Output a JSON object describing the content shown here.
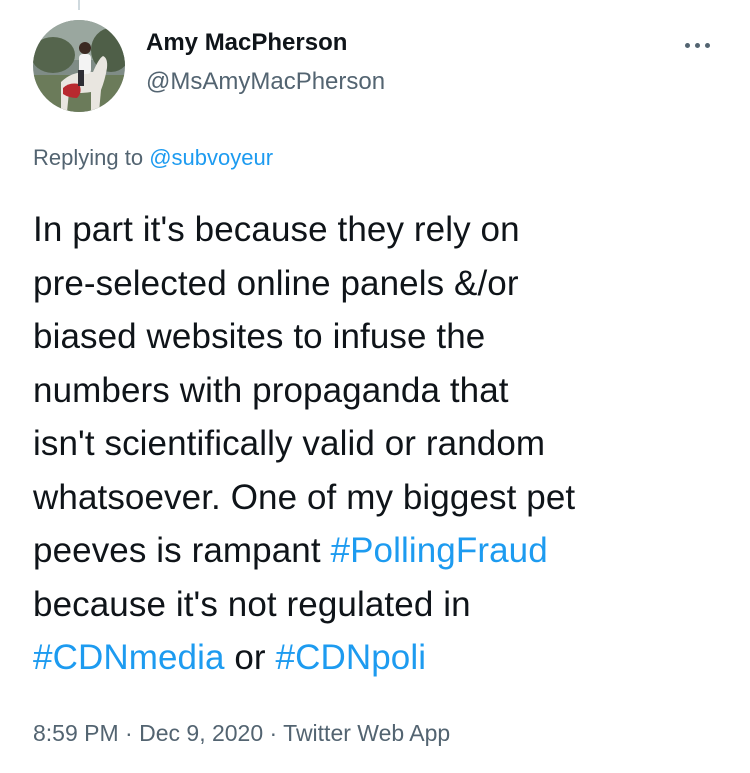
{
  "tweet": {
    "author_name": "Amy MacPherson",
    "author_handle": "@MsAmyMacPherson",
    "replying_prefix": "Replying to ",
    "replying_to": "@subvoyeur",
    "lines": [
      {
        "text": "In part it's because they rely on"
      },
      {
        "text": "pre-selected online panels &/or"
      },
      {
        "text": "biased websites to infuse the"
      },
      {
        "text": "numbers with propaganda that"
      },
      {
        "text": "isn't scientifically valid or random"
      },
      {
        "text": "whatsoever. One of my biggest pet"
      },
      {
        "text": "peeves is rampant ",
        "tag": "#PollingFraud"
      },
      {
        "text": "because it's not regulated in"
      },
      {
        "tag": "#CDNmedia",
        "text": " or ",
        "tag2": "#CDNpoli"
      }
    ],
    "time": "8:59 PM",
    "separator": " · ",
    "date": "Dec 9, 2020",
    "source": "Twitter Web App"
  },
  "icons": {
    "more": "more-horizontal-icon",
    "avatar": "profile-photo-horse-rider"
  },
  "colors": {
    "link": "#1d9bf0",
    "secondary_text": "#536471",
    "primary_text": "#0f1419",
    "background": "#ffffff"
  }
}
